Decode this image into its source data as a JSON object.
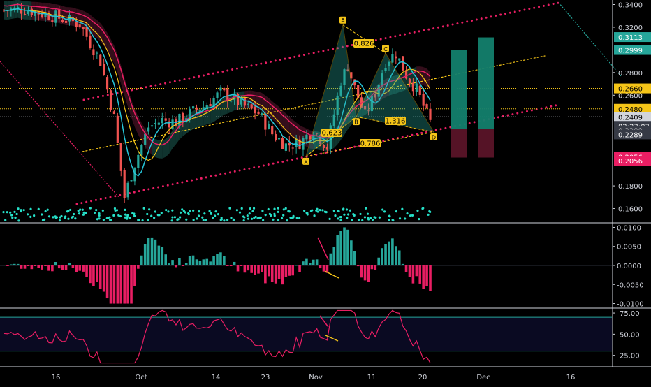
{
  "chart_data": [
    {
      "type": "candlestick",
      "title": "",
      "y_scale": "linear",
      "ylim": [
        0.148,
        0.344
      ],
      "y_ticks": [
        "0.3400",
        "0.3200",
        "0.2800",
        "0.2600",
        "0.1800",
        "0.1600"
      ],
      "x_ticks": [
        "16",
        "Oct",
        "14",
        "23",
        "Nov",
        "11",
        "20",
        "Dec",
        "16"
      ],
      "price_tags": [
        {
          "text": "0.3113",
          "value": 0.3113,
          "color": "#26a69a"
        },
        {
          "text": "0.2999",
          "value": 0.2999,
          "color": "#26a69a"
        },
        {
          "text": "0.2660",
          "value": 0.266,
          "color": "#f5c518"
        },
        {
          "text": "0.2480",
          "value": 0.248,
          "color": "#f5c518"
        },
        {
          "text": "0.2409",
          "value": 0.2409,
          "color": "#d1d4dc"
        },
        {
          "text": "02:23:03",
          "value": 0.2329,
          "color": "#363a45"
        },
        {
          "text": "0.2289",
          "value": 0.2289,
          "color": "#363a45"
        },
        {
          "text": "0.2289",
          "value": 0.2254,
          "color": "#363a45"
        },
        {
          "text": "0.2056",
          "value": 0.2056,
          "color": "#e91e63"
        },
        {
          "text": "0.2056",
          "value": 0.2021,
          "color": "#e91e63"
        }
      ],
      "horizontal_lines": [
        {
          "value": 0.266,
          "color": "#f5c518"
        },
        {
          "value": 0.248,
          "color": "#f5c518"
        },
        {
          "value": 0.2409,
          "color": "#d1d4dc"
        }
      ],
      "harmonic_pattern": {
        "points": [
          {
            "label": "X",
            "value": 0.206
          },
          {
            "label": "A",
            "value": 0.322
          },
          {
            "label": "B",
            "value": 0.241
          },
          {
            "label": "C",
            "value": 0.297
          },
          {
            "label": "D",
            "value": 0.2275
          }
        ],
        "ratios": [
          "0.826",
          "0.623",
          "1.316",
          "0.786"
        ]
      },
      "targets": [
        {
          "top": 0.3,
          "mid": 0.23,
          "bottom": 0.205
        },
        {
          "top": 0.311,
          "mid": 0.23,
          "bottom": 0.205
        }
      ],
      "series": [
        {
          "kind": "candles",
          "color_up": "#26a69a",
          "color_down": "#ef5350",
          "points": 125
        },
        {
          "kind": "ma",
          "color": "#26c6da"
        },
        {
          "kind": "ma",
          "color": "#e91e63"
        },
        {
          "kind": "ma",
          "color": "#f5c518"
        },
        {
          "kind": "dots",
          "color": "#26e0c8"
        }
      ]
    },
    {
      "type": "bar",
      "title": "",
      "ylim": [
        -0.011,
        0.011
      ],
      "y_ticks": [
        "0.0100",
        "0.0050",
        "0.0000",
        "-0.0050",
        "-0.0100"
      ],
      "color_up": "#26a69a",
      "color_down": "#e91e63"
    },
    {
      "type": "line",
      "title": "",
      "ylim": [
        14,
        80
      ],
      "y_ticks": [
        "75.00",
        "50.00",
        "25.00"
      ],
      "band": [
        70,
        30
      ],
      "color": "#e91e63"
    }
  ]
}
